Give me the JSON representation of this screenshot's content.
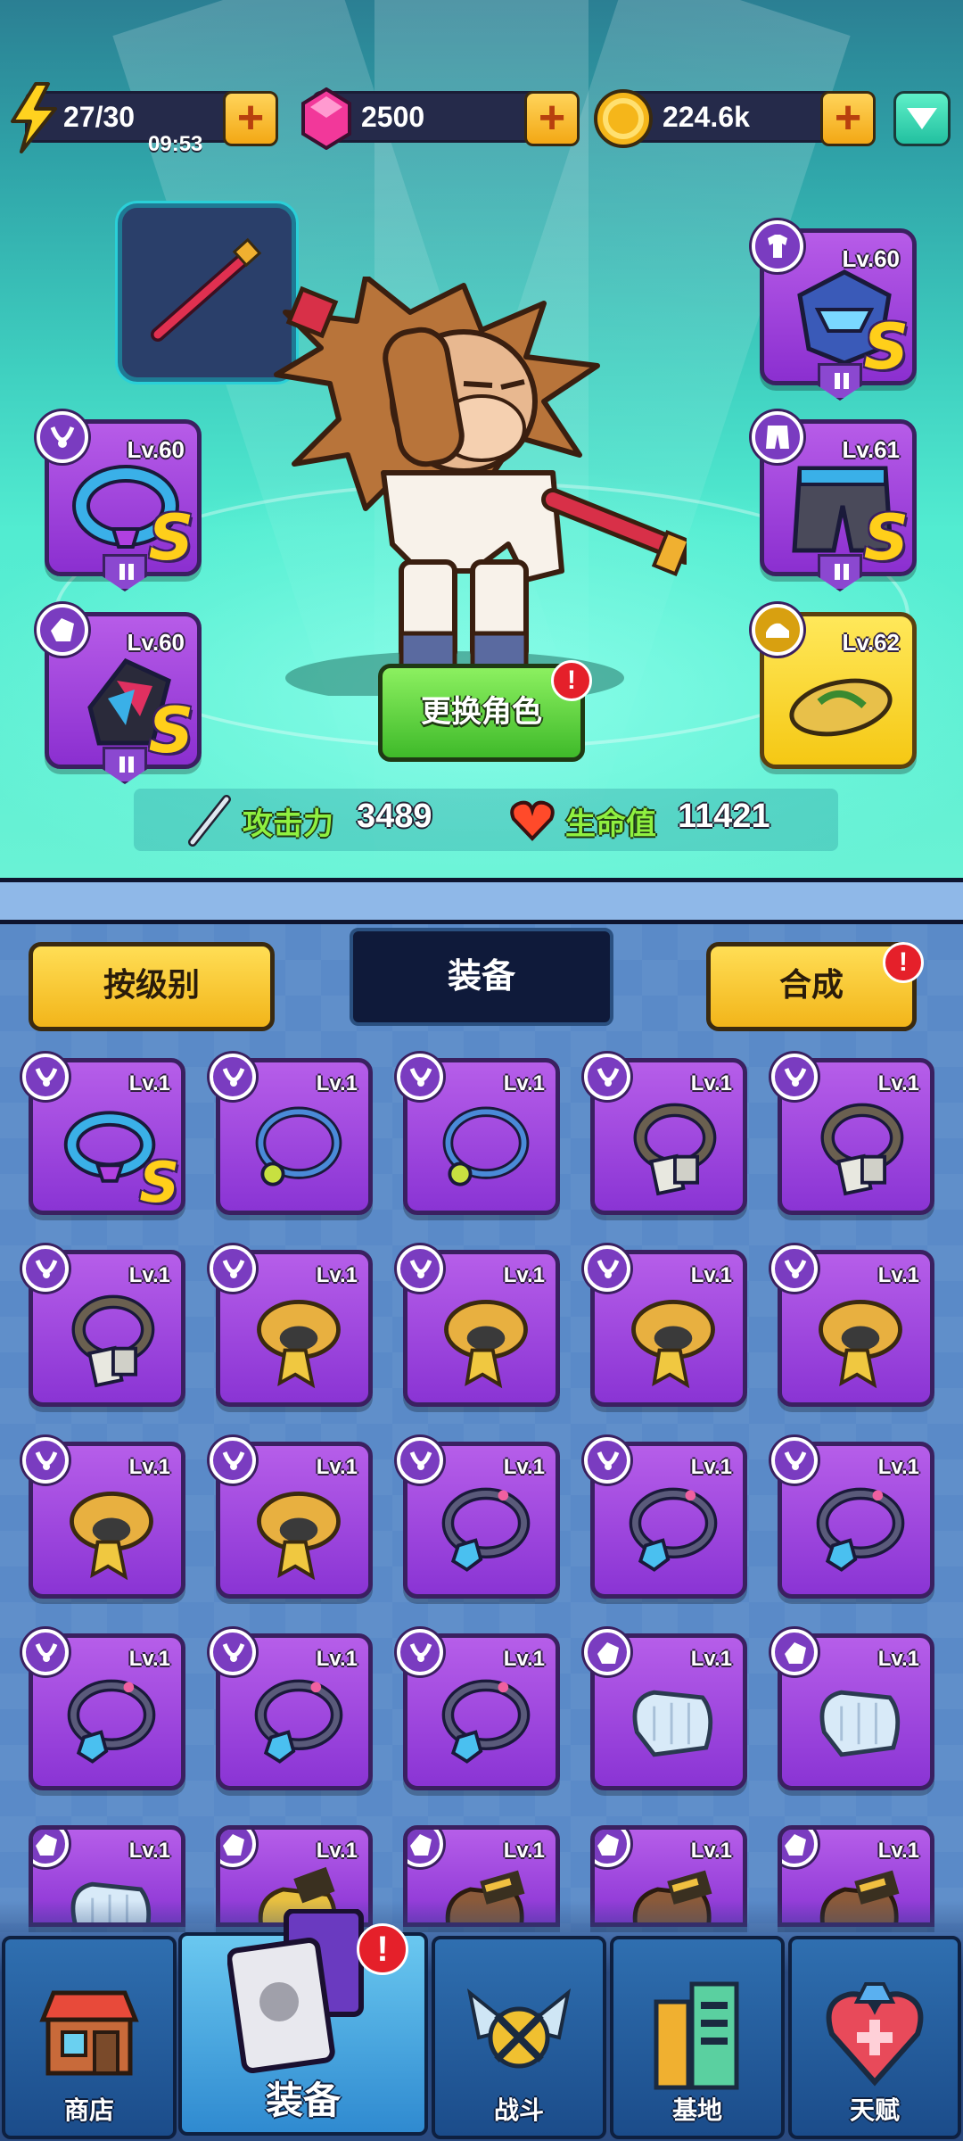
{
  "resources": {
    "energy": "27/30",
    "energy_timer": "09:53",
    "gems": "2500",
    "coins": "224.6k",
    "plus": "+"
  },
  "hero": {
    "change_button": "更换角色",
    "alert": "!",
    "slots": [
      {
        "id": "helmet",
        "level": "Lv.60",
        "grade": "S",
        "icon": "helmet-icon"
      },
      {
        "id": "necklace",
        "level": "Lv.60",
        "grade": "S",
        "icon": "necklace-icon"
      },
      {
        "id": "pants",
        "level": "Lv.61",
        "grade": "S",
        "icon": "pants-icon"
      },
      {
        "id": "gloves",
        "level": "Lv.60",
        "grade": "S",
        "icon": "glove-icon"
      },
      {
        "id": "shoes",
        "level": "Lv.62",
        "grade": "",
        "icon": "sandal-icon"
      }
    ],
    "stats": {
      "attack_label": "攻击力",
      "attack_value": "3489",
      "hp_label": "生命值",
      "hp_value": "11421"
    }
  },
  "inventory": {
    "sort_button": "按级别",
    "tab_label": "装备",
    "merge_button": "合成",
    "merge_alert": "!",
    "items": [
      {
        "level": "Lv.1",
        "type": "necklace",
        "icon": "cyber-collar-icon",
        "grade": "S"
      },
      {
        "level": "Lv.1",
        "type": "necklace",
        "icon": "ring-necklace-icon",
        "grade": ""
      },
      {
        "level": "Lv.1",
        "type": "necklace",
        "icon": "ring-necklace-icon",
        "grade": ""
      },
      {
        "level": "Lv.1",
        "type": "necklace",
        "icon": "dog-tag-icon",
        "grade": ""
      },
      {
        "level": "Lv.1",
        "type": "necklace",
        "icon": "dog-tag-icon",
        "grade": ""
      },
      {
        "level": "Lv.1",
        "type": "necklace",
        "icon": "dog-tag-icon",
        "grade": ""
      },
      {
        "level": "Lv.1",
        "type": "necklace",
        "icon": "scarf-icon",
        "grade": ""
      },
      {
        "level": "Lv.1",
        "type": "necklace",
        "icon": "scarf-icon",
        "grade": ""
      },
      {
        "level": "Lv.1",
        "type": "necklace",
        "icon": "scarf-icon",
        "grade": ""
      },
      {
        "level": "Lv.1",
        "type": "necklace",
        "icon": "scarf-icon",
        "grade": ""
      },
      {
        "level": "Lv.1",
        "type": "necklace",
        "icon": "scarf-icon",
        "grade": ""
      },
      {
        "level": "Lv.1",
        "type": "necklace",
        "icon": "scarf-icon",
        "grade": ""
      },
      {
        "level": "Lv.1",
        "type": "necklace",
        "icon": "gem-pendant-icon",
        "grade": ""
      },
      {
        "level": "Lv.1",
        "type": "necklace",
        "icon": "gem-pendant-icon",
        "grade": ""
      },
      {
        "level": "Lv.1",
        "type": "necklace",
        "icon": "gem-pendant-icon",
        "grade": ""
      },
      {
        "level": "Lv.1",
        "type": "necklace",
        "icon": "gem-pendant-icon",
        "grade": ""
      },
      {
        "level": "Lv.1",
        "type": "necklace",
        "icon": "gem-pendant-icon",
        "grade": ""
      },
      {
        "level": "Lv.1",
        "type": "necklace",
        "icon": "gem-pendant-icon",
        "grade": ""
      },
      {
        "level": "Lv.1",
        "type": "glove",
        "icon": "cloth-glove-icon",
        "grade": ""
      },
      {
        "level": "Lv.1",
        "type": "glove",
        "icon": "cloth-glove-icon",
        "grade": ""
      },
      {
        "level": "Lv.1",
        "type": "glove",
        "icon": "cloth-glove-icon",
        "grade": ""
      },
      {
        "level": "Lv.1",
        "type": "glove",
        "icon": "yellow-glove-icon",
        "grade": ""
      },
      {
        "level": "Lv.1",
        "type": "glove",
        "icon": "leather-glove-icon",
        "grade": ""
      },
      {
        "level": "Lv.1",
        "type": "glove",
        "icon": "leather-glove-icon",
        "grade": ""
      },
      {
        "level": "Lv.1",
        "type": "glove",
        "icon": "leather-glove-icon",
        "grade": ""
      }
    ]
  },
  "nav": {
    "items": [
      {
        "label": "商店",
        "icon": "shop-icon"
      },
      {
        "label": "装备",
        "icon": "equipment-card-icon"
      },
      {
        "label": "战斗",
        "icon": "battle-wings-icon"
      },
      {
        "label": "基地",
        "icon": "base-building-icon"
      },
      {
        "label": "天赋",
        "icon": "talent-heart-icon"
      }
    ],
    "alert": "!"
  }
}
